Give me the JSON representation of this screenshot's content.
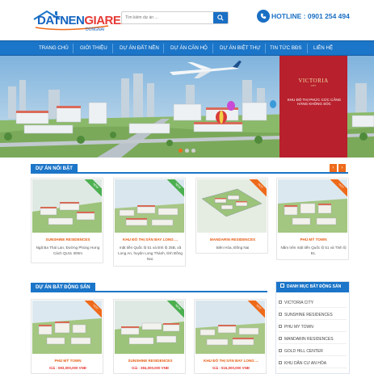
{
  "brand": {
    "logo_text_a": "DATNEN",
    "logo_text_b": "GIARE",
    "logo_domain": "DONGNAI",
    "logo_com": ".com",
    "primary_color": "#1b75c8",
    "accent_color": "#ee6a1a"
  },
  "header": {
    "search_placeholder": "Tìm kiếm dự án ...",
    "hotline_label": "HOTLINE : 0901 254 494"
  },
  "nav": {
    "items": [
      "TRANG CHỦ",
      "GIỚI THIỆU",
      "DỰ ÁN ĐẤT NỀN",
      "DỰ ÁN CĂN HỘ",
      "DỰ ÁN BIỆT THỰ",
      "TIN TỨC BĐS",
      "LIÊN HỆ"
    ]
  },
  "banner": {
    "brand_name": "VICTORIA",
    "brand_sub": "CITY",
    "slogan": "KHU ĐÔ THỊ PHỨC CỨC CẢNG HÀNG KHÔNG SÓC"
  },
  "featured": {
    "heading": "DỰ ÁN NỔI BẬT",
    "prev_icon": "chevron-left-icon",
    "next_icon": "chevron-right-icon",
    "cards": [
      {
        "title": "SUNSHINE RESIDENCES",
        "desc": "Ngã Ba Thái Lan, Đường Phùng Hưng Cách QL51 300m",
        "badge": "NEW"
      },
      {
        "title": "KHU ĐÔ THỊ SÂN BAY LONG ...",
        "desc": "mặt tiền Quốc lộ 51 và tỉnh lộ 25B, xã Long An, huyện Long Thành, tỉnh Đồng Nai.",
        "badge": "NEW"
      },
      {
        "title": "MANDARIN RESIDENCES",
        "desc": "Biên Hòa, Đồng Nai",
        "badge": "HOT"
      },
      {
        "title": "PHÚ MỸ TOWN",
        "desc": "Nằm trên mặt tiền Quốc lộ 51 và Tỉnh lộ 81.",
        "badge": "HOT"
      }
    ]
  },
  "listing": {
    "heading": "DỰ ÁN BẤT ĐỘNG SẢN",
    "cards": [
      {
        "title": "PHÚ MỸ TOWN",
        "price": "Giá : 593,000,000 VNĐ",
        "badge": "HOT"
      },
      {
        "title": "SUNSHINE RESIDENCES",
        "price": "Giá : 384,000,000 VNĐ",
        "badge": "NEW"
      },
      {
        "title": "KHU ĐÔ THỊ SÂN BAY LONG ...",
        "price": "Giá : 516,000,000 VNĐ",
        "badge": "HOT"
      }
    ]
  },
  "sidebar": {
    "heading": "DANH MỤC BẤT ĐỘNG SẢN",
    "items": [
      "VICTORIA CITY",
      "SUNSHINE RESIDENCES",
      "PHU MY TOWN",
      "MANDARIN RESIDENCES",
      "GOLD HILL CENTER",
      "KHU DÂN CƯ AN HÒA"
    ]
  }
}
